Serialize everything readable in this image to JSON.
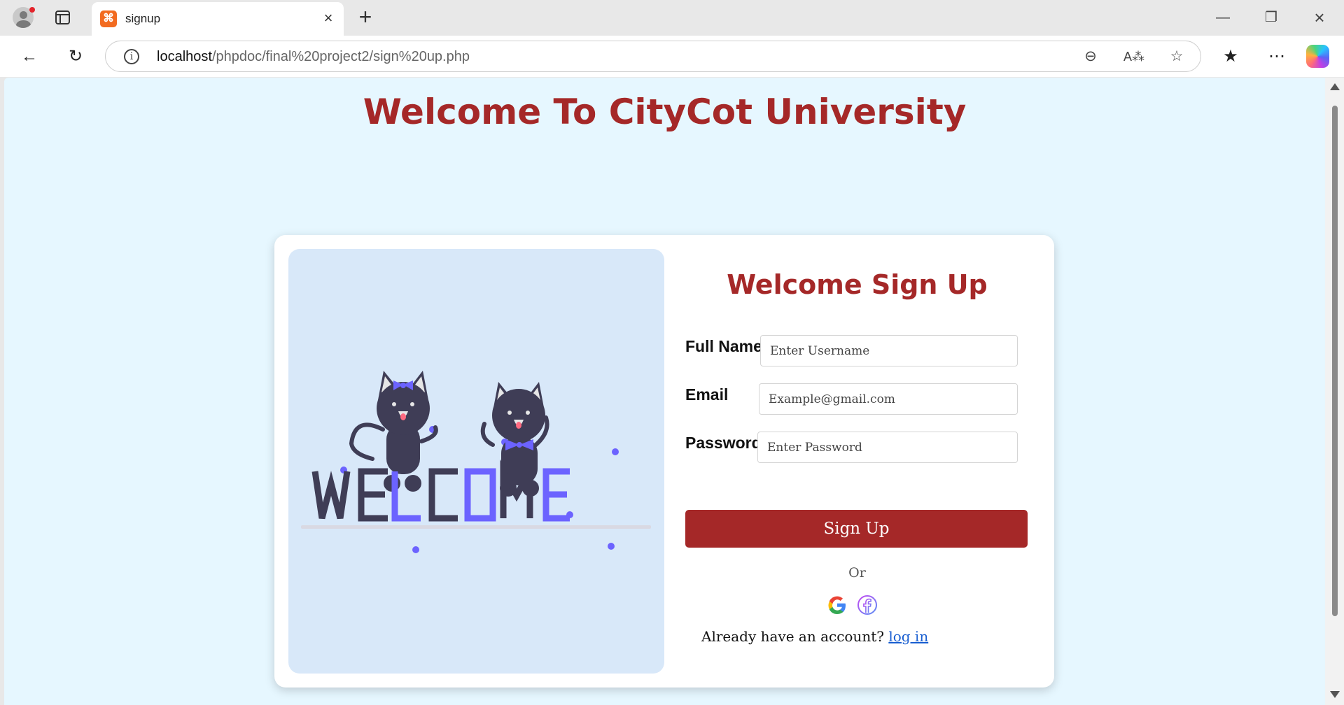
{
  "browser": {
    "tab_title": "signup",
    "url_host": "localhost",
    "url_path": "/phpdoc/final%20project2/sign%20up.php",
    "accent": "#f26b20"
  },
  "page": {
    "title": "Welcome To CityCot University",
    "title_color": "#a52828",
    "background": "#e6f7ff"
  },
  "illustration": {
    "text": "WELCOME",
    "colors": {
      "dark": "#3f3d56",
      "accent": "#6c63ff"
    }
  },
  "form": {
    "title": "Welcome Sign Up",
    "fields": [
      {
        "label": "Full Name",
        "placeholder": "Enter Username",
        "type": "text"
      },
      {
        "label": "Email",
        "placeholder": "Example@gmail.com",
        "type": "email"
      },
      {
        "label": "Password",
        "placeholder": "Enter Password",
        "type": "password"
      }
    ],
    "submit_label": "Sign Up",
    "or_text": "Or",
    "social": [
      "google-icon",
      "facebook-icon"
    ],
    "login_prompt": "Already have an account?",
    "login_link": "log in"
  }
}
